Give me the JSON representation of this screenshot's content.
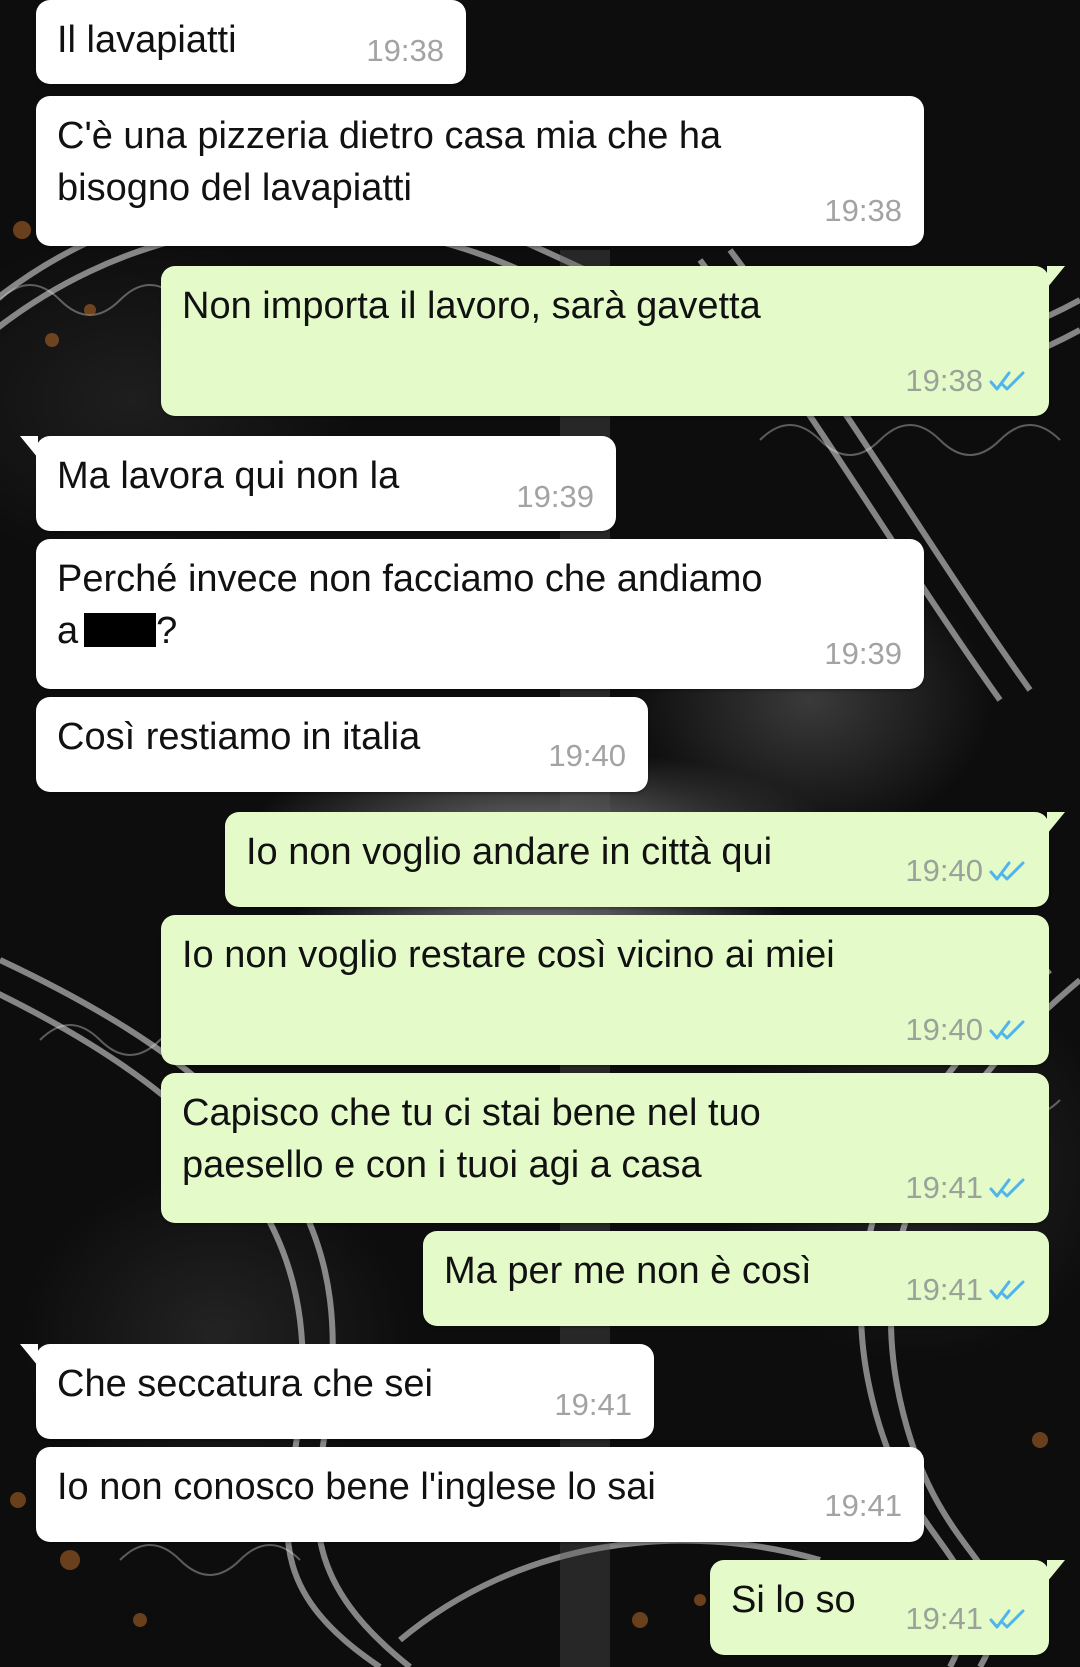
{
  "chat": {
    "messages": [
      {
        "direction": "in",
        "lines": [
          "Il lavapiatti"
        ],
        "time": "19:38"
      },
      {
        "direction": "in",
        "lines": [
          "C'è una pizzeria dietro casa mia che ha",
          "bisogno del lavapiatti"
        ],
        "time": "19:38"
      },
      {
        "direction": "out",
        "lines": [
          "Non importa il lavoro, sarà gavetta"
        ],
        "time": "19:38",
        "status": "read"
      },
      {
        "direction": "in",
        "lines": [
          "Ma lavora qui non la"
        ],
        "time": "19:39"
      },
      {
        "direction": "in",
        "lines": [
          "Perché invece non facciamo che andiamo",
          "a",
          "?"
        ],
        "time": "19:39",
        "redacted": true
      },
      {
        "direction": "in",
        "lines": [
          "Così restiamo in italia"
        ],
        "time": "19:40"
      },
      {
        "direction": "out",
        "lines": [
          "Io non voglio andare in città qui"
        ],
        "time": "19:40",
        "status": "read"
      },
      {
        "direction": "out",
        "lines": [
          "Io non voglio restare così vicino ai miei"
        ],
        "time": "19:40",
        "status": "read"
      },
      {
        "direction": "out",
        "lines": [
          "Capisco che tu ci stai bene nel tuo",
          "paesello e con i tuoi agi a casa"
        ],
        "time": "19:41",
        "status": "read"
      },
      {
        "direction": "out",
        "lines": [
          "Ma per me non è così"
        ],
        "time": "19:41",
        "status": "read"
      },
      {
        "direction": "in",
        "lines": [
          "Che seccatura che sei"
        ],
        "time": "19:41"
      },
      {
        "direction": "in",
        "lines": [
          "Io non conosco bene l'inglese lo sai"
        ],
        "time": "19:41"
      },
      {
        "direction": "out",
        "lines": [
          "Si lo so"
        ],
        "time": "19:41",
        "status": "read"
      }
    ]
  },
  "icons": {
    "read_receipt": "double-check-icon"
  },
  "colors": {
    "incoming_bubble": "#ffffff",
    "outgoing_bubble": "#e4fbc9",
    "timestamp": "#9aa39a",
    "read_ticks": "#4fb5ec"
  }
}
